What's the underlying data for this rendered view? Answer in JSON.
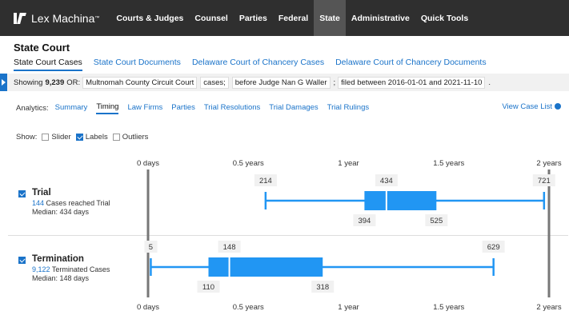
{
  "nav": {
    "brand": "Lex Machina",
    "items": [
      {
        "label": "Courts & Judges",
        "active": false
      },
      {
        "label": "Counsel",
        "active": false
      },
      {
        "label": "Parties",
        "active": false
      },
      {
        "label": "Federal",
        "active": false
      },
      {
        "label": "State",
        "active": true
      },
      {
        "label": "Administrative",
        "active": false
      },
      {
        "label": "Quick Tools",
        "active": false
      }
    ]
  },
  "page_title": "State Court",
  "subtabs": [
    {
      "label": "State Court Cases",
      "active": true
    },
    {
      "label": "State Court Documents",
      "active": false
    },
    {
      "label": "Delaware Court of Chancery Cases",
      "active": false
    },
    {
      "label": "Delaware Court of Chancery Documents",
      "active": false
    }
  ],
  "query": {
    "showing_label": "Showing",
    "count": "9,239",
    "prefix": "OR:",
    "court": "Multnomah County Circuit Court",
    "cases_label": "cases;",
    "judge": "before Judge Nan G Waller",
    "sep": ";",
    "filed": "filed between 2016-01-01 and 2021-11-10",
    "end": "."
  },
  "analytics": {
    "label": "Analytics:",
    "tabs": [
      {
        "label": "Summary",
        "active": false
      },
      {
        "label": "Timing",
        "active": true
      },
      {
        "label": "Law Firms",
        "active": false
      },
      {
        "label": "Parties",
        "active": false
      },
      {
        "label": "Trial Resolutions",
        "active": false
      },
      {
        "label": "Trial Damages",
        "active": false
      },
      {
        "label": "Trial Rulings",
        "active": false
      }
    ],
    "view_case_list": "View Case List"
  },
  "show": {
    "label": "Show:",
    "options": [
      {
        "label": "Slider",
        "checked": false
      },
      {
        "label": "Labels",
        "checked": true
      },
      {
        "label": "Outliers",
        "checked": false
      }
    ]
  },
  "rows": [
    {
      "title": "Trial",
      "count": "144",
      "count_text": "Cases reached Trial",
      "median_text": "Median: 434 days",
      "checked": true
    },
    {
      "title": "Termination",
      "count": "9,122",
      "count_text": "Terminated Cases",
      "median_text": "Median: 148 days",
      "checked": true
    }
  ],
  "colors": {
    "accent": "#1a73c9",
    "box": "#2196f3",
    "nav_bg": "#2f2f2f"
  },
  "chart_data": {
    "type": "boxplot",
    "x_ticks": [
      {
        "value": 0,
        "label": "0 days"
      },
      {
        "value": 182.5,
        "label": "0.5 years"
      },
      {
        "value": 365,
        "label": "1 year"
      },
      {
        "value": 547.5,
        "label": "1.5 years"
      },
      {
        "value": 730,
        "label": "2 years"
      }
    ],
    "xlim": [
      0,
      730
    ],
    "series": [
      {
        "name": "Trial",
        "min": 214,
        "q1": 394,
        "median": 434,
        "q3": 525,
        "max": 721
      },
      {
        "name": "Termination",
        "min": 5,
        "q1": 110,
        "median": 148,
        "q3": 318,
        "max": 629
      }
    ]
  }
}
